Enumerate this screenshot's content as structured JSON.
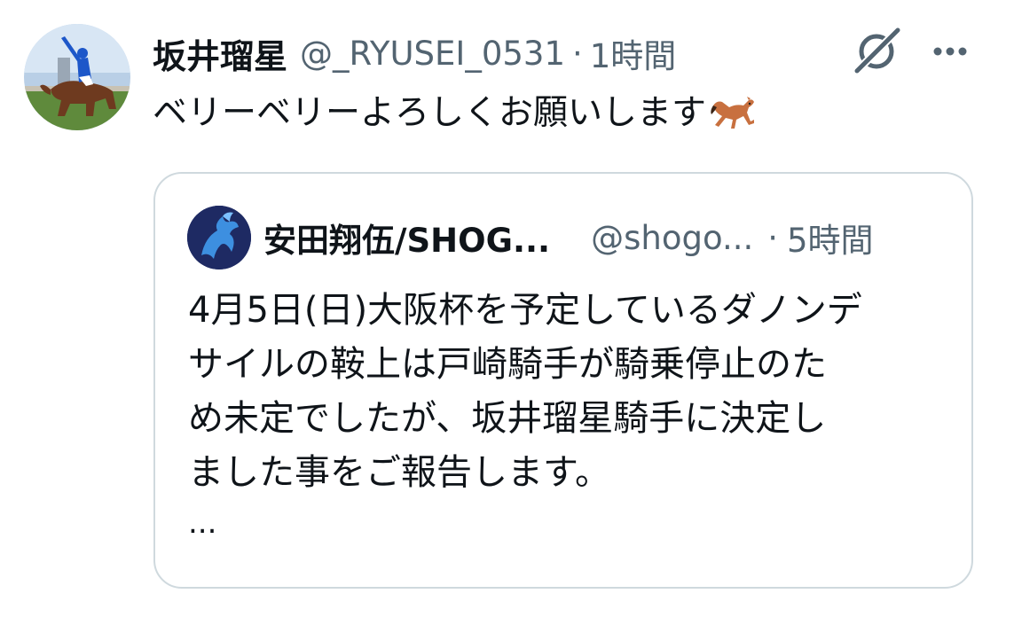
{
  "tweet": {
    "author_name": "坂井瑠星",
    "author_handle": "@_RYUSEI_0531",
    "separator": "·",
    "time": "1時間",
    "text": "ベリーベリーよろしくお願いします",
    "emoji": "horse-icon"
  },
  "actions": {
    "grok_icon": "grok-icon",
    "more_icon": "more-icon",
    "more_label": "···"
  },
  "quote": {
    "author_name": "安田翔伍/SHOG...",
    "author_handle": "@shogo...",
    "separator": "·",
    "time": "5時間",
    "lines": [
      "4月5日(日)大阪杯を予定しているダノンデ",
      "サイルの鞍上は戸崎騎手が騎乗停止のた",
      "め未定でしたが、坂井瑠星騎手に決定し",
      "ました事をご報告します。"
    ],
    "ellipsis": "..."
  },
  "colors": {
    "text": "#0f1419",
    "secondary": "#536471",
    "border": "#cfd9de"
  }
}
